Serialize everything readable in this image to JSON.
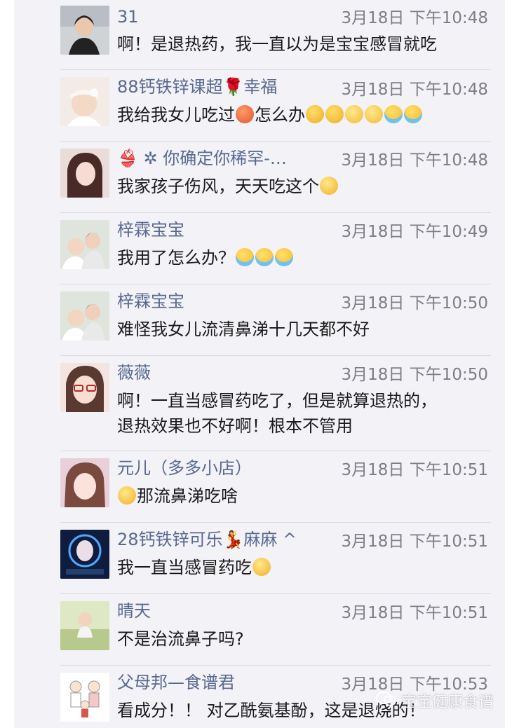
{
  "comments": [
    {
      "name": "31",
      "time": "3月18日 下午10:48",
      "text": [
        "啊！是退热药，我一直以为是宝宝感冒就吃"
      ],
      "emojis": [],
      "avatar_color": "#dcdcdc"
    },
    {
      "name": "88钙铁锌课超🌹幸福",
      "time": "3月18日 下午10:48",
      "text": [
        "我给我女儿吃过",
        "怎么办"
      ],
      "emojis": [
        "angry",
        "laugh",
        "laugh",
        "confused",
        "confused",
        "cry",
        "cry"
      ],
      "avatar_color": "#f0e8e2"
    },
    {
      "name": "👙 ✲ 你确定你稀罕-…",
      "time": "3月18日 下午10:48",
      "text": [
        "我家孩子伤风，天天吃这个"
      ],
      "emojis": [
        "shock"
      ],
      "avatar_color": "#e6d6d0"
    },
    {
      "name": "梓霖宝宝",
      "time": "3月18日 下午10:49",
      "text": [
        "我用了怎么办？"
      ],
      "emojis": [
        "cry",
        "cry",
        "cry"
      ],
      "avatar_color": "#e8e4dc"
    },
    {
      "name": "梓霖宝宝",
      "time": "3月18日 下午10:50",
      "text": [
        "难怪我女儿流清鼻涕十几天都不好"
      ],
      "emojis": [],
      "avatar_color": "#e8e4dc"
    },
    {
      "name": "薇薇",
      "time": "3月18日 下午10:50",
      "text": [
        "啊！一直当感冒药吃了，但是就算退热的，",
        "退热效果也不好啊！根本不管用"
      ],
      "emojis": [],
      "avatar_color": "#f1dcd6"
    },
    {
      "name": "元儿（多多小店）",
      "time": "3月18日 下午10:51",
      "text": [
        "那流鼻涕吃啥"
      ],
      "emojis": [
        "shock"
      ],
      "avatar_color": "#e7d0d6"
    },
    {
      "name": "28钙铁锌可乐💃麻麻 ^",
      "time": "3月18日 下午10:51",
      "text": [
        "我一直当感冒药吃"
      ],
      "emojis": [
        "shock"
      ],
      "avatar_color": "#1f3f7a"
    },
    {
      "name": "晴天",
      "time": "3月18日 下午10:51",
      "text": [
        "不是治流鼻子吗?"
      ],
      "emojis": [],
      "avatar_color": "#d7e2b8"
    },
    {
      "name": "父母邦—食谱君",
      "time": "3月18日 下午10:53",
      "text": [
        "看成分！！ 对乙酰氨基酚，这是退烧的！"
      ],
      "emojis": [],
      "avatar_color": "#ffffff"
    }
  ],
  "watermark": {
    "text": "宝宝健康食谱",
    "icon": "wechat-icon"
  }
}
